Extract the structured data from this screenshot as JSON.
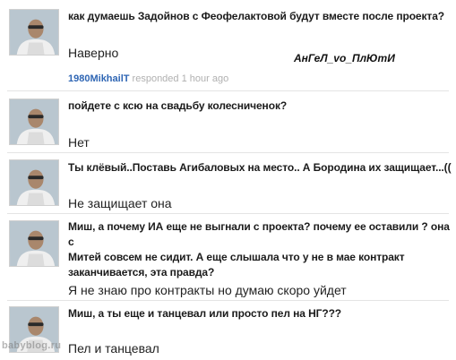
{
  "qa": [
    {
      "question": "как думаешь Задойнов с Феофелактовой будут вместе после проекта?",
      "answer": "Наверно",
      "responder": "1980MikhailT",
      "responded_text": "responded 1 hour ago",
      "signature": "АнГеЛ_vo_ПлЮтИ"
    },
    {
      "question": "пойдете с ксю на свадьбу колесниченок?",
      "answer": "Нет"
    },
    {
      "question": "Ты клёвый..Поставь Агибаловых на место.. А Бородина их защищает...((",
      "answer": "Не защищает она"
    },
    {
      "question_lines": [
        "Миш, а почему ИА еще не выгнали с проекта? почему ее оставили ? она с",
        "Митей совсем не сидит. А еще слышала что у не в мае контракт",
        "заканчивается, эта правда?"
      ],
      "answer": "Я не знаю про контракты но думаю скоро уйдет"
    },
    {
      "question": "Миш, а ты еще и танцевал или просто пел на НГ???",
      "answer": "Пел и танцевал"
    }
  ],
  "watermark": "babyblog.ru",
  "icons": [
    "user-avatar-photo"
  ]
}
